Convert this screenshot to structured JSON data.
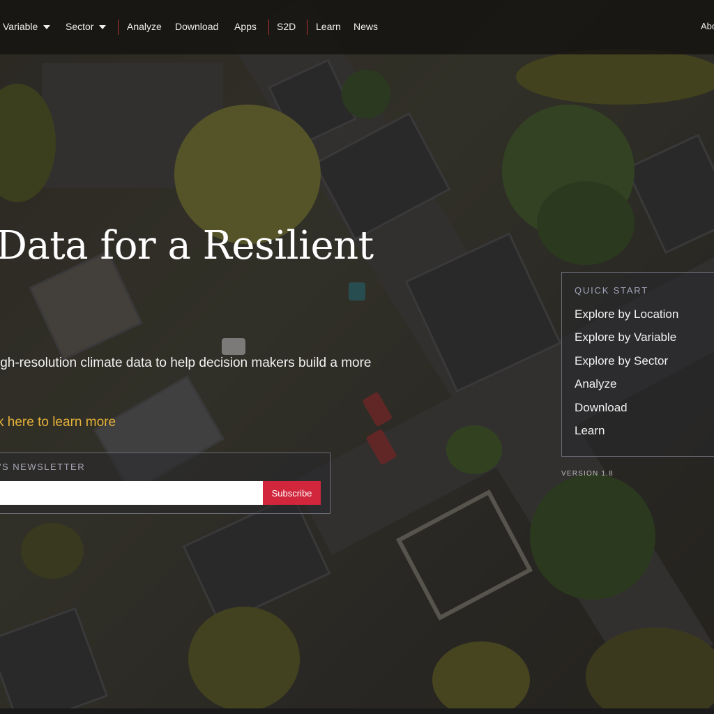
{
  "nav": {
    "items": [
      {
        "label": "Variable",
        "dropdown": true
      },
      {
        "label": "Sector",
        "dropdown": true
      },
      {
        "label": "Analyze",
        "dropdown": false
      },
      {
        "label": "Download",
        "dropdown": false
      },
      {
        "label": "Apps",
        "dropdown": false
      },
      {
        "label": "S2D",
        "dropdown": false
      },
      {
        "label": "Learn",
        "dropdown": false
      },
      {
        "label": "News",
        "dropdown": false
      }
    ],
    "right_item": "Abo"
  },
  "hero": {
    "title": "Data for a Resilient",
    "subtitle": "igh-resolution climate data to help decision makers build a more",
    "learn_link": "k here to learn more"
  },
  "newsletter": {
    "label": "'S NEWSLETTER",
    "input_value": "",
    "input_placeholder": "",
    "subscribe_label": "Subscribe"
  },
  "quick_start": {
    "title": "QUICK START",
    "items": [
      "Explore by Location",
      "Explore by Variable",
      "Explore by Sector",
      "Analyze",
      "Download",
      "Learn"
    ]
  },
  "version": "VERSION 1.8",
  "colors": {
    "accent_red": "#d1263c",
    "link_gold": "#e6b23a",
    "nav_bg": "#161412"
  }
}
